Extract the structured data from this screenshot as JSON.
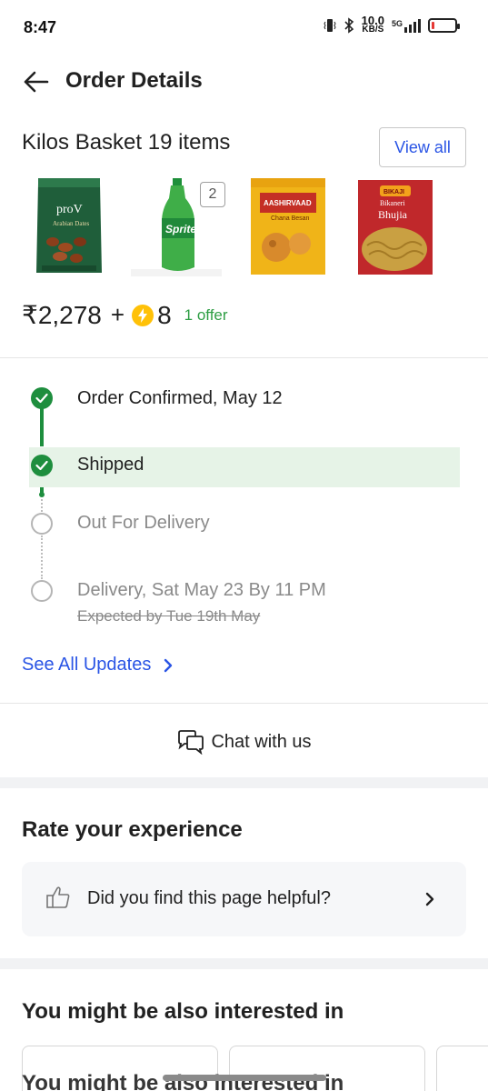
{
  "status_bar": {
    "time": "8:47",
    "speed_value": "10.0",
    "speed_unit": "KB/S",
    "network": "5G",
    "battery_level_percent": 12,
    "battery_color": "#e53935"
  },
  "header": {
    "title": "Order Details",
    "back_icon": "arrow-left-icon"
  },
  "basket": {
    "title": "Kilos Basket 19 items",
    "view_all_label": "View all",
    "products": [
      {
        "name": "proV Arabian Dates",
        "icon": "dates-pack-image"
      },
      {
        "name": "Sprite",
        "icon": "sprite-bottle-image",
        "quantity_badge": "2"
      },
      {
        "name": "Aashirvaad Chana Besan",
        "icon": "besan-pack-image"
      },
      {
        "name": "Bikaji Bikaneri Bhujia",
        "icon": "bhujia-pack-image"
      }
    ]
  },
  "price": {
    "amount": "₹2,278",
    "plus": "+",
    "coins": "8",
    "offer": "1 offer",
    "coin_icon": "supercoin-icon"
  },
  "tracker": {
    "steps": [
      {
        "label": "Order Confirmed, May 12",
        "status": "done"
      },
      {
        "label": "Shipped",
        "status": "current"
      },
      {
        "label": "Out For Delivery",
        "status": "pending"
      },
      {
        "label": "Delivery, Sat May 23 By 11 PM",
        "status": "pending",
        "sub_label": "Expected by Tue 19th May"
      }
    ],
    "see_all_label": "See All Updates",
    "done_color": "#1e8e3e",
    "highlight_color": "#e6f3e7"
  },
  "chat": {
    "label": "Chat with us",
    "icon": "chat-bubbles-icon"
  },
  "rate": {
    "title": "Rate your experience",
    "helpful_question": "Did you find this page helpful?",
    "icon": "thumbs-up-icon"
  },
  "suggestions": {
    "title": "You might be also interested in",
    "ghost_title": "You might be also interested in"
  },
  "colors": {
    "link_blue": "#2a55e5",
    "offer_green": "#2e9e44"
  }
}
